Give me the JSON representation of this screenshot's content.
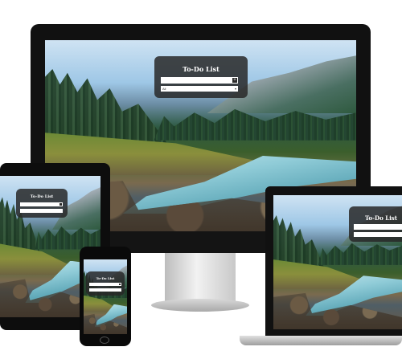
{
  "app": {
    "title": "To-Do List",
    "add_symbol": "+",
    "filter_value": "All"
  },
  "devices": [
    "desktop-monitor",
    "tablet",
    "laptop",
    "phone"
  ],
  "colors": {
    "card_background": "#282828",
    "device_frame": "#111111",
    "page_background": "#ffffff"
  }
}
